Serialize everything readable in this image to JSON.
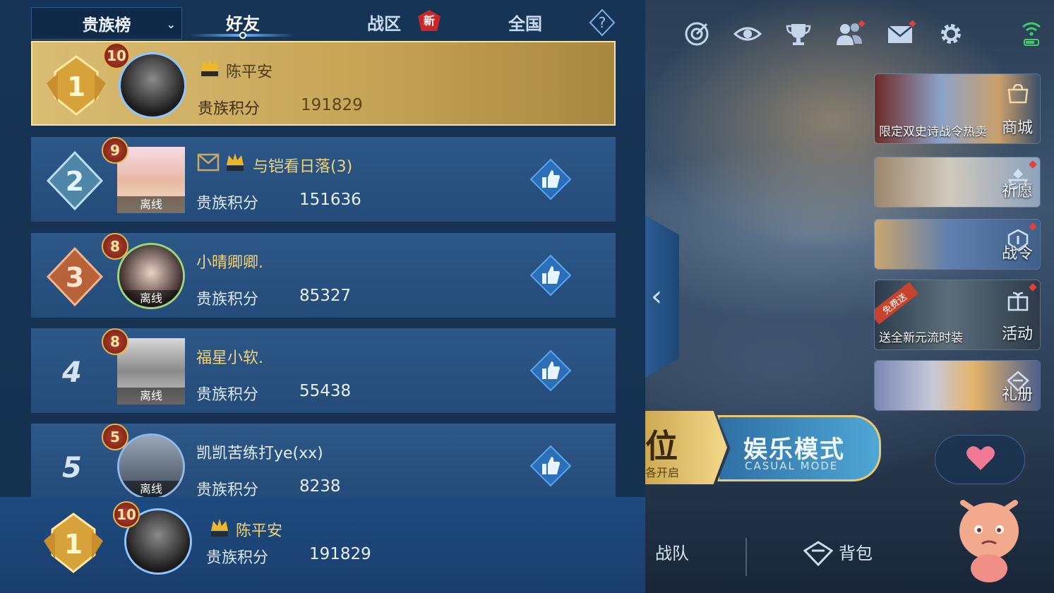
{
  "panel": {
    "dropdown_label": "贵族榜",
    "tabs": [
      "好友",
      "战区",
      "全国"
    ],
    "new_badge": "新",
    "help_symbol": "?"
  },
  "ranking": [
    {
      "rank": "1",
      "level": "10",
      "name": "陈平安",
      "svip": true,
      "offline": "",
      "score_label": "贵族积分",
      "score": "191829"
    },
    {
      "rank": "2",
      "level": "9",
      "name": "与铠看日落(3)",
      "svip": true,
      "offline": "离线",
      "score_label": "贵族积分",
      "score": "151636"
    },
    {
      "rank": "3",
      "level": "8",
      "name": "小晴卿卿.",
      "svip": false,
      "offline": "离线",
      "score_label": "贵族积分",
      "score": "85327"
    },
    {
      "rank": "4",
      "level": "8",
      "name": "福星小软.",
      "svip": false,
      "offline": "离线",
      "score_label": "贵族积分",
      "score": "55438"
    },
    {
      "rank": "5",
      "level": "5",
      "name": "凯凯苦练打ye(xx)",
      "svip": false,
      "offline": "离线",
      "score_label": "贵族积分",
      "score": "8238"
    }
  ],
  "self": {
    "rank": "1",
    "level": "10",
    "name": "陈平安",
    "score_label": "贵族积分",
    "score": "191829"
  },
  "side_menu": [
    {
      "label": "商城",
      "promo": "限定双史诗战令热卖",
      "tag": ""
    },
    {
      "label": "祈愿",
      "promo": "",
      "tag": ""
    },
    {
      "label": "战令",
      "promo": "",
      "tag": ""
    },
    {
      "label": "活动",
      "promo": "送全新元流时装",
      "tag": "免费送"
    },
    {
      "label": "礼册",
      "promo": "",
      "tag": ""
    }
  ],
  "modes": {
    "left_big": "位",
    "left_small": "各开启",
    "right_title": "娱乐模式",
    "right_sub": "CASUAL MODE"
  },
  "bottom": {
    "team": "战队",
    "bag": "背包"
  },
  "colors": {
    "gold": "#f1d27a",
    "panel": "#163455",
    "row": "#2d5888",
    "accent": "#66b5ff"
  }
}
